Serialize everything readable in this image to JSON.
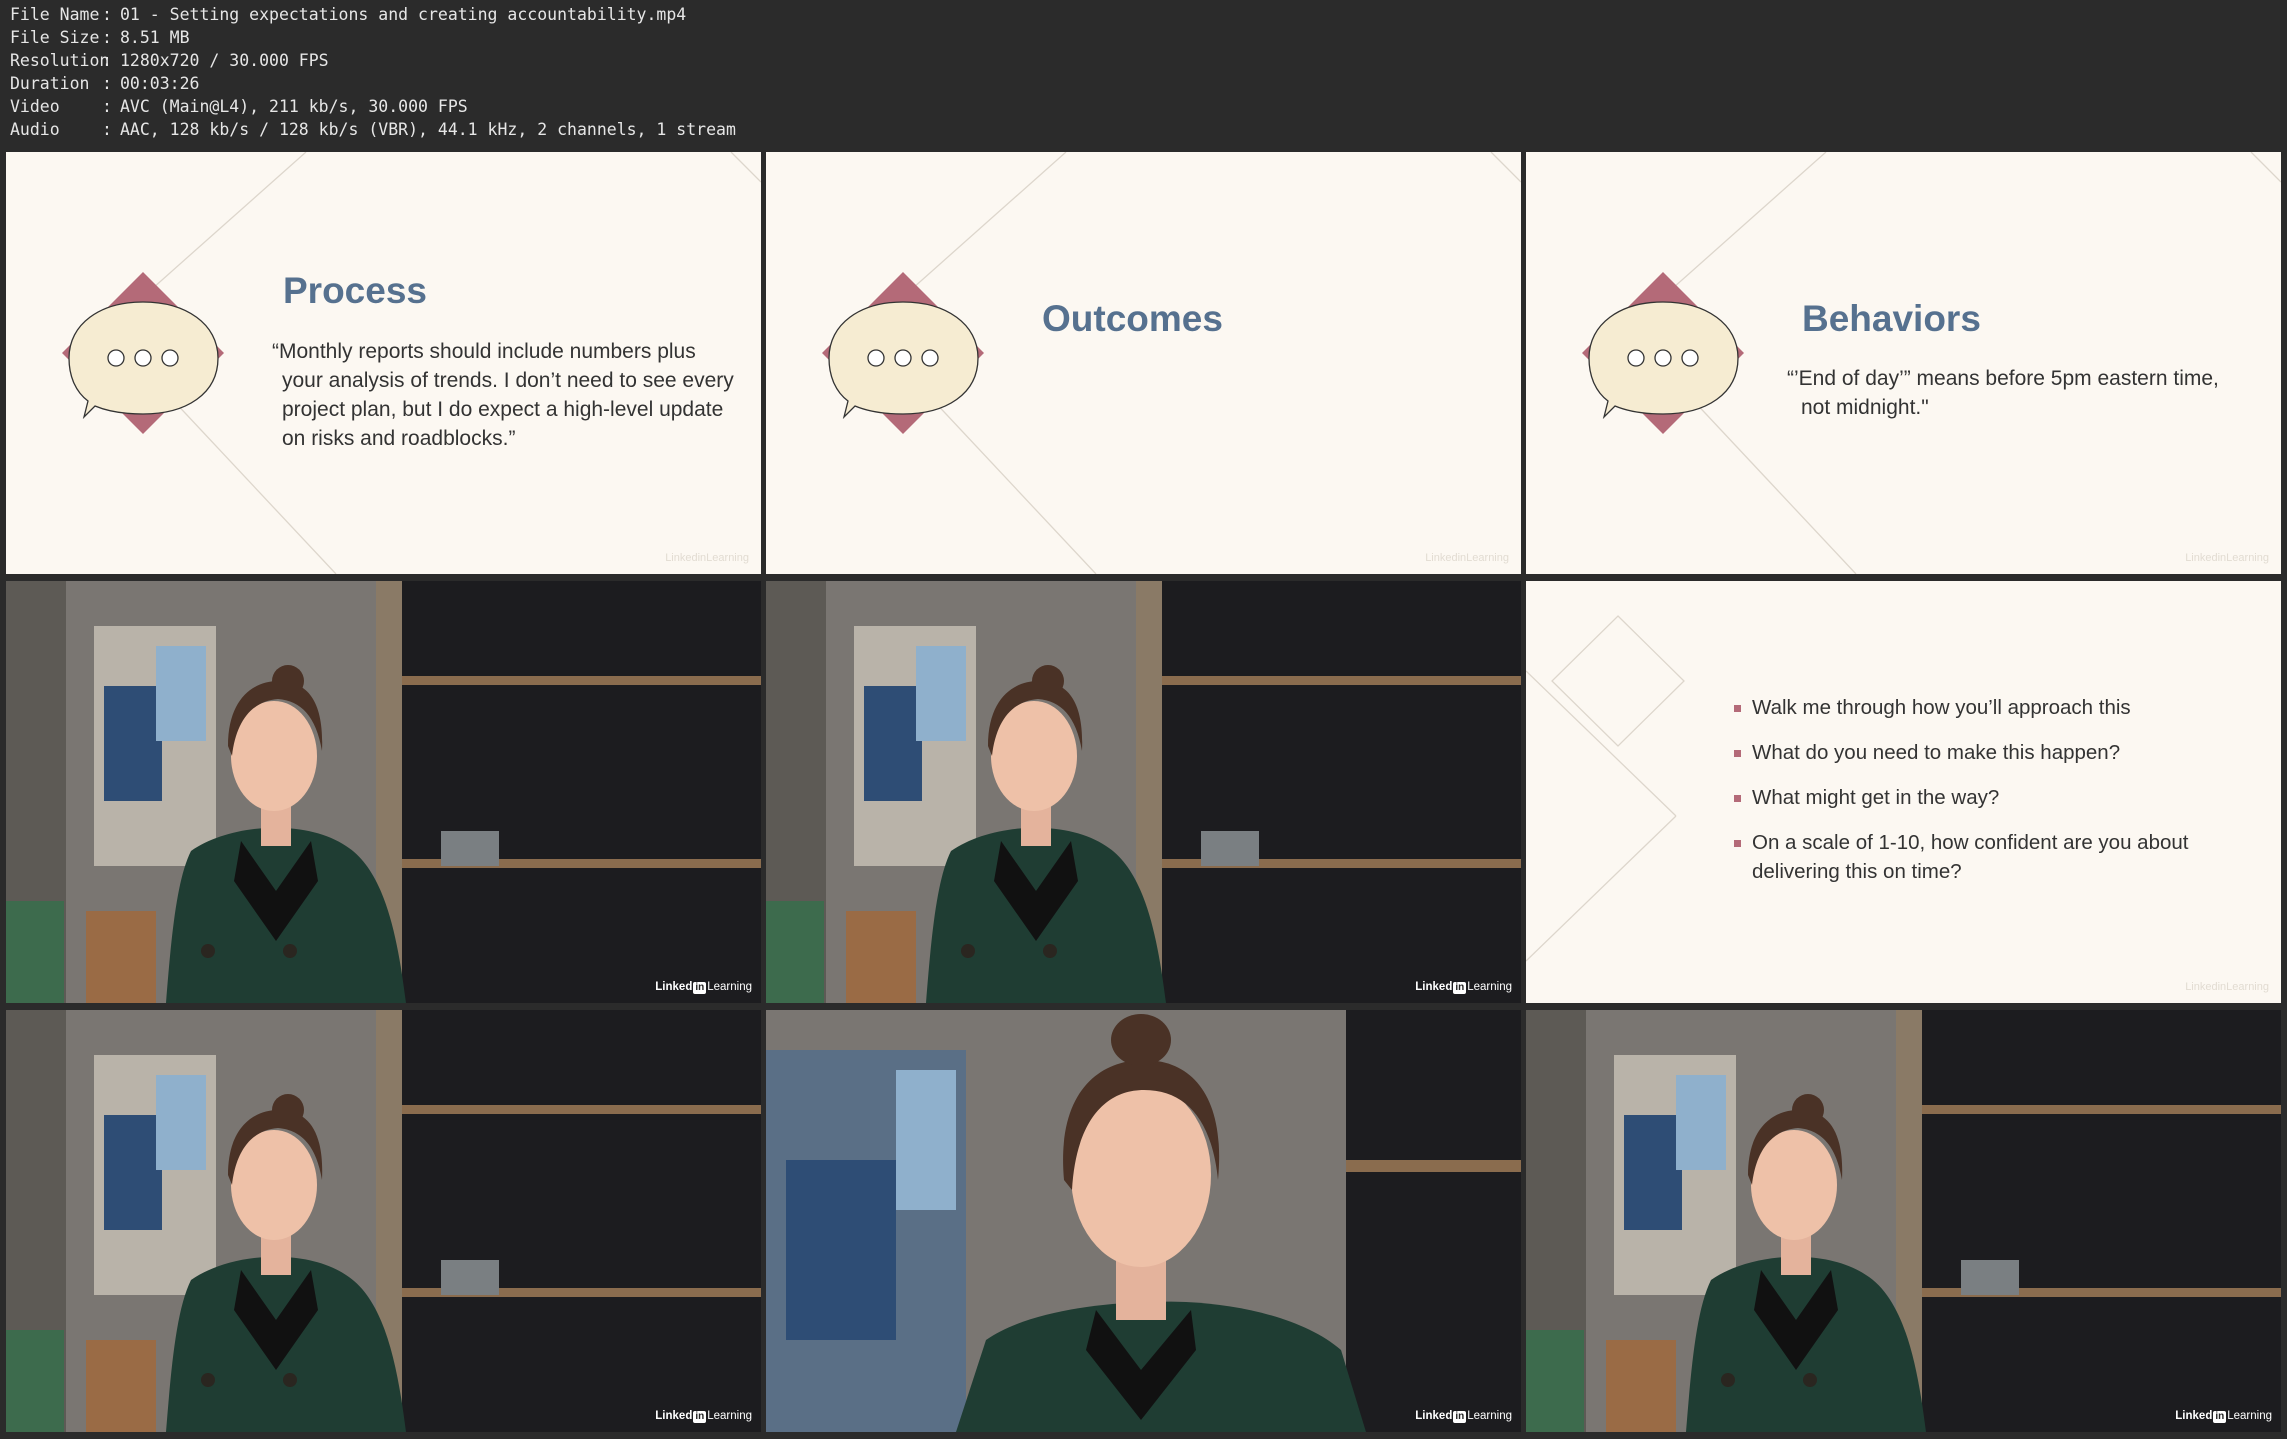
{
  "file_info": [
    {
      "label": "File Name",
      "value": "01 - Setting expectations and creating accountability.mp4"
    },
    {
      "label": "File Size",
      "value": "8.51 MB"
    },
    {
      "label": "Resolution",
      "value": "1280x720 / 30.000 FPS"
    },
    {
      "label": "Duration",
      "value": "00:03:26"
    },
    {
      "label": "Video",
      "value": "AVC (Main@L4), 211 kb/s, 30.000 FPS"
    },
    {
      "label": "Audio",
      "value": "AAC, 128 kb/s / 128 kb/s (VBR), 44.1 kHz, 2 channels, 1 stream"
    }
  ],
  "separator": ":",
  "slides": {
    "process": {
      "title": "Process",
      "lines": [
        "“Monthly reports should include numbers plus",
        "your analysis of trends. I don’t need to see every",
        "project plan, but I do expect a high-level update",
        "on risks and roadblocks.”"
      ]
    },
    "outcomes": {
      "title": "Outcomes"
    },
    "behaviors": {
      "title": "Behaviors",
      "lines": [
        "“’End of day’” means before 5pm eastern time,",
        "not midnight.\""
      ]
    },
    "questions": {
      "items": [
        [
          "Walk me through how you’ll approach this"
        ],
        [
          "What do you need to make this happen?"
        ],
        [
          "What might get in the way?"
        ],
        [
          "On a scale of 1-10, how confident are you about",
          "delivering this on time?"
        ]
      ]
    }
  },
  "watermark": {
    "prefix": "Linked",
    "in": "in",
    "suffix": "Learning"
  },
  "colors": {
    "slide_bg": "#fcf8f2",
    "title": "#56718f",
    "accent": "#b46a78",
    "bubble": "#f6ecd2",
    "jacket": "#1f3d33"
  }
}
